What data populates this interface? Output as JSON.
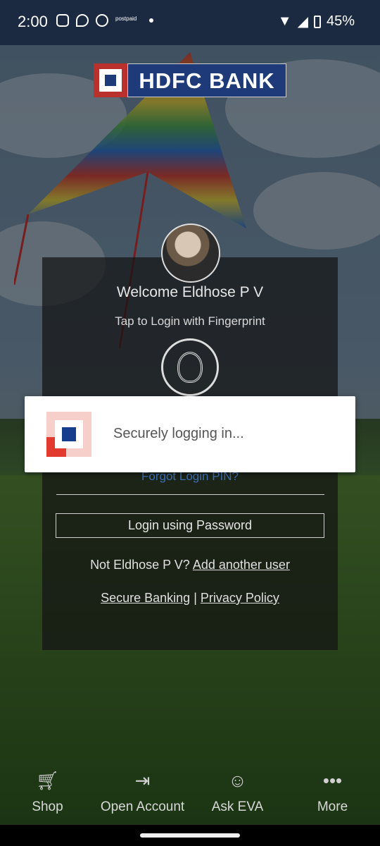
{
  "status_bar": {
    "time": "2:00",
    "carrier_tag": "postpaid",
    "battery": "45%"
  },
  "header": {
    "logo_text": "HDFC BANK"
  },
  "login": {
    "welcome": "Welcome Eldhose P V",
    "tap_text": "Tap to Login with Fingerprint",
    "forgot_pin": "Forgot Login PIN?",
    "password_button": "Login using Password",
    "not_user_prefix": "Not Eldhose P V?",
    "add_user": "Add another user",
    "secure_banking": "Secure Banking",
    "separator": "|",
    "privacy_policy": "Privacy Policy"
  },
  "dialog": {
    "message": "Securely logging in..."
  },
  "bottom_nav": {
    "items": [
      {
        "label": "Shop",
        "icon": "cart-icon"
      },
      {
        "label": "Open Account",
        "icon": "open-account-icon"
      },
      {
        "label": "Ask EVA",
        "icon": "eva-chat-icon"
      },
      {
        "label": "More",
        "icon": "more-dots-icon"
      }
    ]
  },
  "colors": {
    "brand_blue": "#1e3a78",
    "brand_red": "#b9302d",
    "link_blue": "#3e6fb6"
  }
}
